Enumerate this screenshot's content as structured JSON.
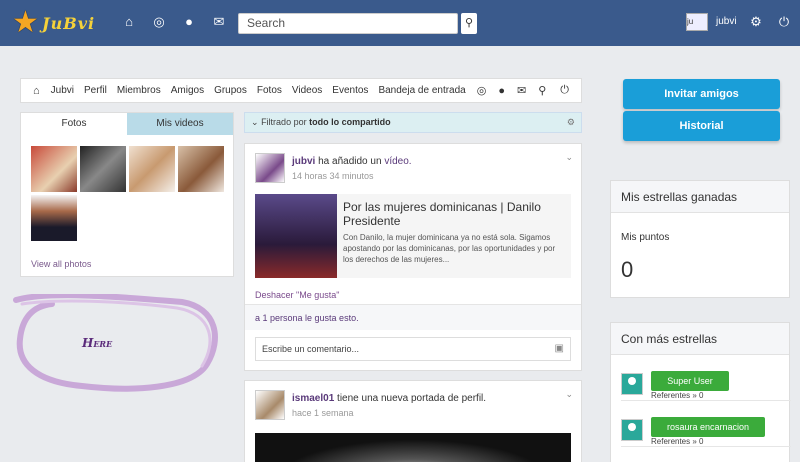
{
  "topbar": {
    "logo_text": "JuBvi",
    "search_placeholder": "Search",
    "user_avatar_alt": "ju",
    "user_name": "jubvi"
  },
  "nav": {
    "items": [
      "Jubvi",
      "Perfil",
      "Miembros",
      "Amigos",
      "Grupos",
      "Fotos",
      "Videos",
      "Eventos",
      "Bandeja de entrada"
    ]
  },
  "photos": {
    "tab_photos": "Fotos",
    "tab_videos": "Mis videos",
    "view_all": "View all photos"
  },
  "annotation": {
    "text": "Here"
  },
  "filter": {
    "prefix": "Filtrado por",
    "value": "todo lo compartido"
  },
  "post1": {
    "author": "jubvi",
    "verb": "ha añadido un",
    "object": "vídeo.",
    "time": "14 horas 34 minutos",
    "video_title": "Por las mujeres dominicanas | Danilo Presidente",
    "video_desc": "Con Danilo, la mujer dominicana ya no está sola. Sigamos apostando por las dominicanas, por las oportunidades y por los derechos de las mujeres...",
    "unlike": "Deshacer \"Me gusta\"",
    "likes": "a 1 persona le gusta esto.",
    "comment_placeholder": "Escribe un comentario..."
  },
  "post2": {
    "author": "ismael01",
    "verb": "tiene una nueva portada de perfil.",
    "time": "hace 1 semana"
  },
  "right": {
    "invite_button": "Invitar amigos",
    "history_button": "Historial",
    "stars_title": "Mis estrellas ganadas",
    "points_label": "Mis puntos",
    "points_value": "0",
    "top_title": "Con más estrellas",
    "top_users": [
      {
        "name": "Super User",
        "ref": "Referentes » 0"
      },
      {
        "name": "rosaura encarnacion",
        "ref": "Referentes » 0"
      }
    ]
  }
}
